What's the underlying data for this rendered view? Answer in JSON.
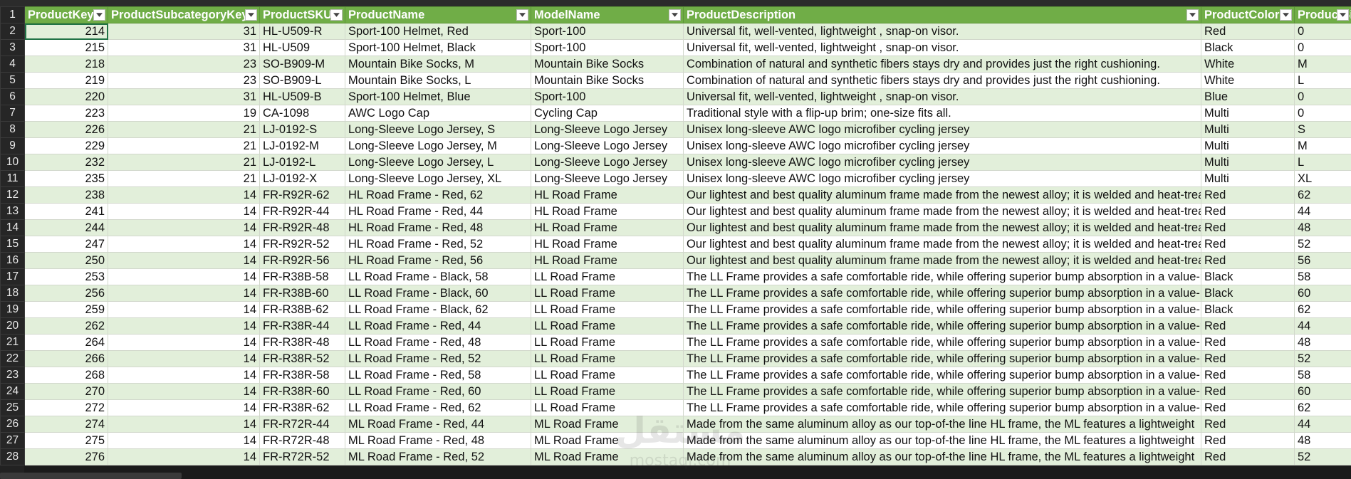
{
  "sheet": {
    "columns": [
      "ProductKey",
      "ProductSubcategoryKey",
      "ProductSKU",
      "ProductName",
      "ModelName",
      "ProductDescription",
      "ProductColor",
      "ProductSi"
    ],
    "rows": [
      {
        "n": "1",
        "cells": []
      },
      {
        "n": "2",
        "cells": [
          "214",
          "31",
          "HL-U509-R",
          "Sport-100 Helmet, Red",
          "Sport-100",
          "Universal fit, well-vented, lightweight , snap-on visor.",
          "Red",
          "0"
        ]
      },
      {
        "n": "3",
        "cells": [
          "215",
          "31",
          "HL-U509",
          "Sport-100 Helmet, Black",
          "Sport-100",
          "Universal fit, well-vented, lightweight , snap-on visor.",
          "Black",
          "0"
        ]
      },
      {
        "n": "4",
        "cells": [
          "218",
          "23",
          "SO-B909-M",
          "Mountain Bike Socks, M",
          "Mountain Bike Socks",
          "Combination of natural and synthetic fibers stays dry and provides just the right cushioning.",
          "White",
          "M"
        ]
      },
      {
        "n": "5",
        "cells": [
          "219",
          "23",
          "SO-B909-L",
          "Mountain Bike Socks, L",
          "Mountain Bike Socks",
          "Combination of natural and synthetic fibers stays dry and provides just the right cushioning.",
          "White",
          "L"
        ]
      },
      {
        "n": "6",
        "cells": [
          "220",
          "31",
          "HL-U509-B",
          "Sport-100 Helmet, Blue",
          "Sport-100",
          "Universal fit, well-vented, lightweight , snap-on visor.",
          "Blue",
          "0"
        ]
      },
      {
        "n": "7",
        "cells": [
          "223",
          "19",
          "CA-1098",
          "AWC Logo Cap",
          "Cycling Cap",
          "Traditional style with a flip-up brim; one-size fits all.",
          "Multi",
          "0"
        ]
      },
      {
        "n": "8",
        "cells": [
          "226",
          "21",
          "LJ-0192-S",
          "Long-Sleeve Logo Jersey, S",
          "Long-Sleeve Logo Jersey",
          "Unisex long-sleeve AWC logo microfiber cycling jersey",
          "Multi",
          "S"
        ]
      },
      {
        "n": "9",
        "cells": [
          "229",
          "21",
          "LJ-0192-M",
          "Long-Sleeve Logo Jersey, M",
          "Long-Sleeve Logo Jersey",
          "Unisex long-sleeve AWC logo microfiber cycling jersey",
          "Multi",
          "M"
        ]
      },
      {
        "n": "10",
        "cells": [
          "232",
          "21",
          "LJ-0192-L",
          "Long-Sleeve Logo Jersey, L",
          "Long-Sleeve Logo Jersey",
          "Unisex long-sleeve AWC logo microfiber cycling jersey",
          "Multi",
          "L"
        ]
      },
      {
        "n": "11",
        "cells": [
          "235",
          "21",
          "LJ-0192-X",
          "Long-Sleeve Logo Jersey, XL",
          "Long-Sleeve Logo Jersey",
          "Unisex long-sleeve AWC logo microfiber cycling jersey",
          "Multi",
          "XL"
        ]
      },
      {
        "n": "12",
        "cells": [
          "238",
          "14",
          "FR-R92R-62",
          "HL Road Frame - Red, 62",
          "HL Road Frame",
          "Our lightest and best quality aluminum frame made from the newest alloy; it is welded and heat-trea",
          "Red",
          "62"
        ]
      },
      {
        "n": "13",
        "cells": [
          "241",
          "14",
          "FR-R92R-44",
          "HL Road Frame - Red, 44",
          "HL Road Frame",
          "Our lightest and best quality aluminum frame made from the newest alloy; it is welded and heat-trea",
          "Red",
          "44"
        ]
      },
      {
        "n": "14",
        "cells": [
          "244",
          "14",
          "FR-R92R-48",
          "HL Road Frame - Red, 48",
          "HL Road Frame",
          "Our lightest and best quality aluminum frame made from the newest alloy; it is welded and heat-trea",
          "Red",
          "48"
        ]
      },
      {
        "n": "15",
        "cells": [
          "247",
          "14",
          "FR-R92R-52",
          "HL Road Frame - Red, 52",
          "HL Road Frame",
          "Our lightest and best quality aluminum frame made from the newest alloy; it is welded and heat-trea",
          "Red",
          "52"
        ]
      },
      {
        "n": "16",
        "cells": [
          "250",
          "14",
          "FR-R92R-56",
          "HL Road Frame - Red, 56",
          "HL Road Frame",
          "Our lightest and best quality aluminum frame made from the newest alloy; it is welded and heat-trea",
          "Red",
          "56"
        ]
      },
      {
        "n": "17",
        "cells": [
          "253",
          "14",
          "FR-R38B-58",
          "LL Road Frame - Black, 58",
          "LL Road Frame",
          "The LL Frame provides a safe comfortable ride, while offering superior bump absorption in a value-p",
          "Black",
          "58"
        ]
      },
      {
        "n": "18",
        "cells": [
          "256",
          "14",
          "FR-R38B-60",
          "LL Road Frame - Black, 60",
          "LL Road Frame",
          "The LL Frame provides a safe comfortable ride, while offering superior bump absorption in a value-p",
          "Black",
          "60"
        ]
      },
      {
        "n": "19",
        "cells": [
          "259",
          "14",
          "FR-R38B-62",
          "LL Road Frame - Black, 62",
          "LL Road Frame",
          "The LL Frame provides a safe comfortable ride, while offering superior bump absorption in a value-p",
          "Black",
          "62"
        ]
      },
      {
        "n": "20",
        "cells": [
          "262",
          "14",
          "FR-R38R-44",
          "LL Road Frame - Red, 44",
          "LL Road Frame",
          "The LL Frame provides a safe comfortable ride, while offering superior bump absorption in a value-p",
          "Red",
          "44"
        ]
      },
      {
        "n": "21",
        "cells": [
          "264",
          "14",
          "FR-R38R-48",
          "LL Road Frame - Red, 48",
          "LL Road Frame",
          "The LL Frame provides a safe comfortable ride, while offering superior bump absorption in a value-p",
          "Red",
          "48"
        ]
      },
      {
        "n": "22",
        "cells": [
          "266",
          "14",
          "FR-R38R-52",
          "LL Road Frame - Red, 52",
          "LL Road Frame",
          "The LL Frame provides a safe comfortable ride, while offering superior bump absorption in a value-p",
          "Red",
          "52"
        ]
      },
      {
        "n": "23",
        "cells": [
          "268",
          "14",
          "FR-R38R-58",
          "LL Road Frame - Red, 58",
          "LL Road Frame",
          "The LL Frame provides a safe comfortable ride, while offering superior bump absorption in a value-p",
          "Red",
          "58"
        ]
      },
      {
        "n": "24",
        "cells": [
          "270",
          "14",
          "FR-R38R-60",
          "LL Road Frame - Red, 60",
          "LL Road Frame",
          "The LL Frame provides a safe comfortable ride, while offering superior bump absorption in a value-p",
          "Red",
          "60"
        ]
      },
      {
        "n": "25",
        "cells": [
          "272",
          "14",
          "FR-R38R-62",
          "LL Road Frame - Red, 62",
          "LL Road Frame",
          "The LL Frame provides a safe comfortable ride, while offering superior bump absorption in a value-p",
          "Red",
          "62"
        ]
      },
      {
        "n": "26",
        "cells": [
          "274",
          "14",
          "FR-R72R-44",
          "ML Road Frame - Red, 44",
          "ML Road Frame",
          "Made from the same aluminum alloy as our top-of-the line HL frame, the ML features a lightweight",
          "Red",
          "44"
        ]
      },
      {
        "n": "27",
        "cells": [
          "275",
          "14",
          "FR-R72R-48",
          "ML Road Frame - Red, 48",
          "ML Road Frame",
          "Made from the same aluminum alloy as our top-of-the line HL frame, the ML features a lightweight",
          "Red",
          "48"
        ]
      },
      {
        "n": "28",
        "cells": [
          "276",
          "14",
          "FR-R72R-52",
          "ML Road Frame - Red, 52",
          "ML Road Frame",
          "Made from the same aluminum alloy as our top-of-the line HL frame, the ML features a lightweight",
          "Red",
          "52"
        ]
      }
    ]
  },
  "watermark": {
    "arabic": "مستقل",
    "latin": "mostaql.com"
  },
  "colors": {
    "header": "#70ad47",
    "band": "#e2efda",
    "selection": "#217346"
  }
}
